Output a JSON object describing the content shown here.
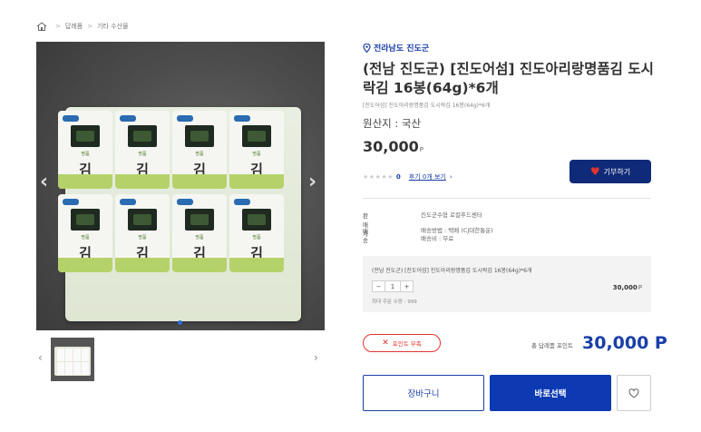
{
  "breadcrumb": {
    "items": [
      "답례품",
      "기타 수산물"
    ],
    "separator": ">"
  },
  "gallery": {
    "product_label": "명품",
    "product_main": "김",
    "prev_icon": "chevron-left-icon",
    "next_icon": "chevron-right-icon",
    "active_slide": 1
  },
  "product": {
    "region": "전라남도 진도군",
    "title": "(전남 진도군) [진도어섬] 진도아리랑명품김 도시락김 16봉(64g)*6개",
    "subtitle": "[진도어섬] 진도아리랑명품김 도시락김 16봉(64g)*6개",
    "origin": "원산지 : 국산",
    "price": "30,000",
    "price_unit": "P",
    "rating_count": "0",
    "review_link": "후기 0개 보기",
    "review_chevron": "›",
    "donate_label": "기부하기"
  },
  "info": {
    "seller_key": "판매자",
    "seller_value": "진도군수협 로컬푸드센터",
    "shipping_key": "배송",
    "shipping_method": "배송방법 : 택배 (CJ대한통운)",
    "shipping_fee": "배송비 : 무료"
  },
  "option": {
    "name": "(전남 진도군) [진도어섬] 진도아리랑명품김 도시락김 16봉(64g)*6개",
    "minus": "−",
    "quantity": "1",
    "plus": "+",
    "price": "30,000",
    "price_unit": "P",
    "max_qty": "최대 주문 수량 : 999"
  },
  "summary": {
    "points_button": "포인트 부족",
    "total_label": "총 답례품 포인트",
    "total_price": "30,000 P"
  },
  "actions": {
    "cart": "장바구니",
    "buy": "바로선택"
  },
  "colors": {
    "accent": "#1a3ea8",
    "buy_bg": "#0d3ab2",
    "donate_bg": "#0f2a78",
    "alert": "#e5322d"
  }
}
